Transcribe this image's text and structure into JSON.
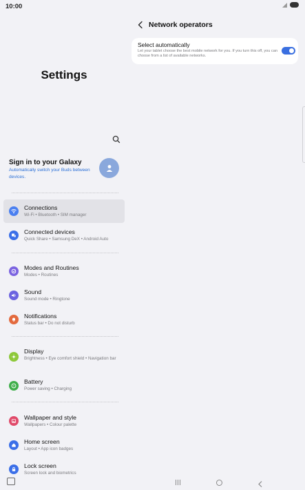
{
  "status_bar": {
    "time": "10:00"
  },
  "left": {
    "title": "Settings",
    "account": {
      "title": "Sign in to your Galaxy",
      "subtitle": "Automatically switch your Buds between devices."
    },
    "items": [
      {
        "label": "Connections",
        "sub": "Wi-Fi  •  Bluetooth  •  SIM manager",
        "icon": "wifi-icon",
        "color": "#4a7ff0"
      },
      {
        "label": "Connected devices",
        "sub": "Quick Share  •  Samsung DeX  •  Android Auto",
        "icon": "connected-devices-icon",
        "color": "#3b6fe8"
      },
      {
        "label": "Modes and Routines",
        "sub": "Modes  •  Routines",
        "icon": "modes-icon",
        "color": "#7b63e0"
      },
      {
        "label": "Sound",
        "sub": "Sound mode  •  Ringtone",
        "icon": "sound-icon",
        "color": "#6b63e0"
      },
      {
        "label": "Notifications",
        "sub": "Status bar  •  Do not disturb",
        "icon": "notifications-icon",
        "color": "#e36a3e"
      },
      {
        "label": "Display",
        "sub": "Brightness  •  Eye comfort shield  •  Navigation bar",
        "icon": "display-icon",
        "color": "#8dc83a"
      },
      {
        "label": "Battery",
        "sub": "Power saving  •  Charging",
        "icon": "battery-icon",
        "color": "#3fae4a"
      },
      {
        "label": "Wallpaper and style",
        "sub": "Wallpapers  •  Colour palette",
        "icon": "wallpaper-icon",
        "color": "#e04a6a"
      },
      {
        "label": "Home screen",
        "sub": "Layout  •  App icon badges",
        "icon": "home-screen-icon",
        "color": "#3b6fe8"
      },
      {
        "label": "Lock screen",
        "sub": "Screen lock and biometrics",
        "icon": "lock-icon",
        "color": "#3b6fe8"
      }
    ]
  },
  "right": {
    "title": "Network operators",
    "select_auto": {
      "title": "Select automatically",
      "desc": "Let your tablet choose the best mobile network for you. If you turn this off, you can choose from a list of available networks.",
      "enabled": true,
      "accent": "#3a6fe0"
    }
  }
}
